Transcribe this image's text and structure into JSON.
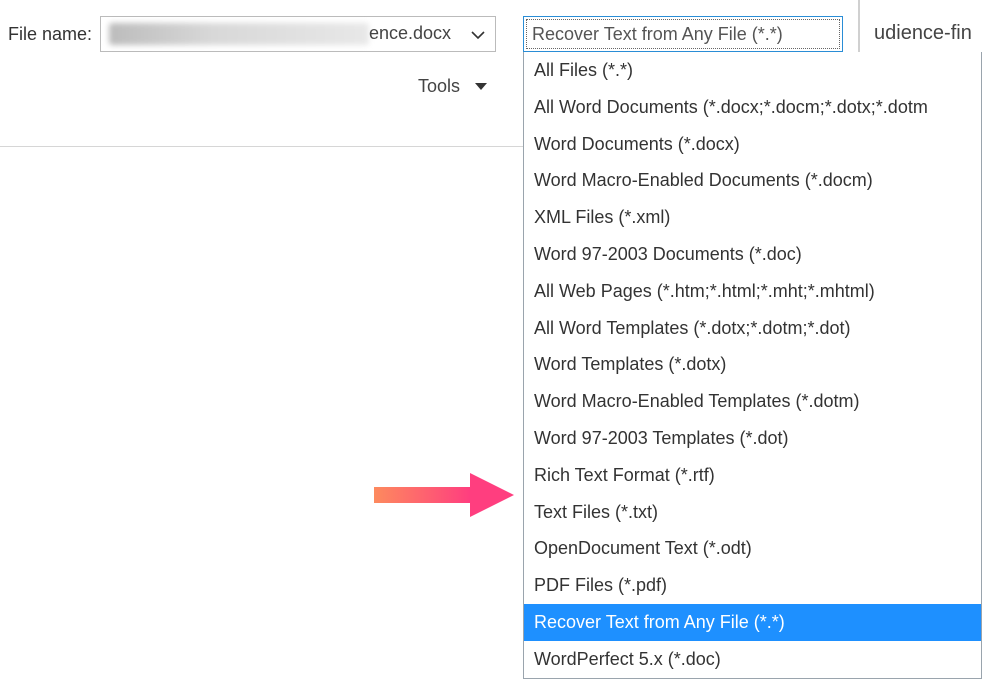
{
  "label": "File name:",
  "filename_tail": "ence.docx",
  "filetype_selected": "Recover Text from Any File (*.*)",
  "tools_label": "Tools",
  "right_panel_text": "udience-fin",
  "dropdown": [
    {
      "label": "All Files (*.*)",
      "highlight": false
    },
    {
      "label": "All Word Documents (*.docx;*.docm;*.dotx;*.dotm",
      "highlight": false
    },
    {
      "label": "Word Documents (*.docx)",
      "highlight": false
    },
    {
      "label": "Word Macro-Enabled Documents (*.docm)",
      "highlight": false
    },
    {
      "label": "XML Files (*.xml)",
      "highlight": false
    },
    {
      "label": "Word 97-2003 Documents (*.doc)",
      "highlight": false
    },
    {
      "label": "All Web Pages (*.htm;*.html;*.mht;*.mhtml)",
      "highlight": false
    },
    {
      "label": "All Word Templates (*.dotx;*.dotm;*.dot)",
      "highlight": false
    },
    {
      "label": "Word Templates (*.dotx)",
      "highlight": false
    },
    {
      "label": "Word Macro-Enabled Templates (*.dotm)",
      "highlight": false
    },
    {
      "label": "Word 97-2003 Templates (*.dot)",
      "highlight": false
    },
    {
      "label": "Rich Text Format (*.rtf)",
      "highlight": false
    },
    {
      "label": "Text Files (*.txt)",
      "highlight": false
    },
    {
      "label": "OpenDocument Text (*.odt)",
      "highlight": false
    },
    {
      "label": "PDF Files (*.pdf)",
      "highlight": false
    },
    {
      "label": "Recover Text from Any File (*.*)",
      "highlight": true
    },
    {
      "label": "WordPerfect 5.x (*.doc)",
      "highlight": false
    }
  ]
}
